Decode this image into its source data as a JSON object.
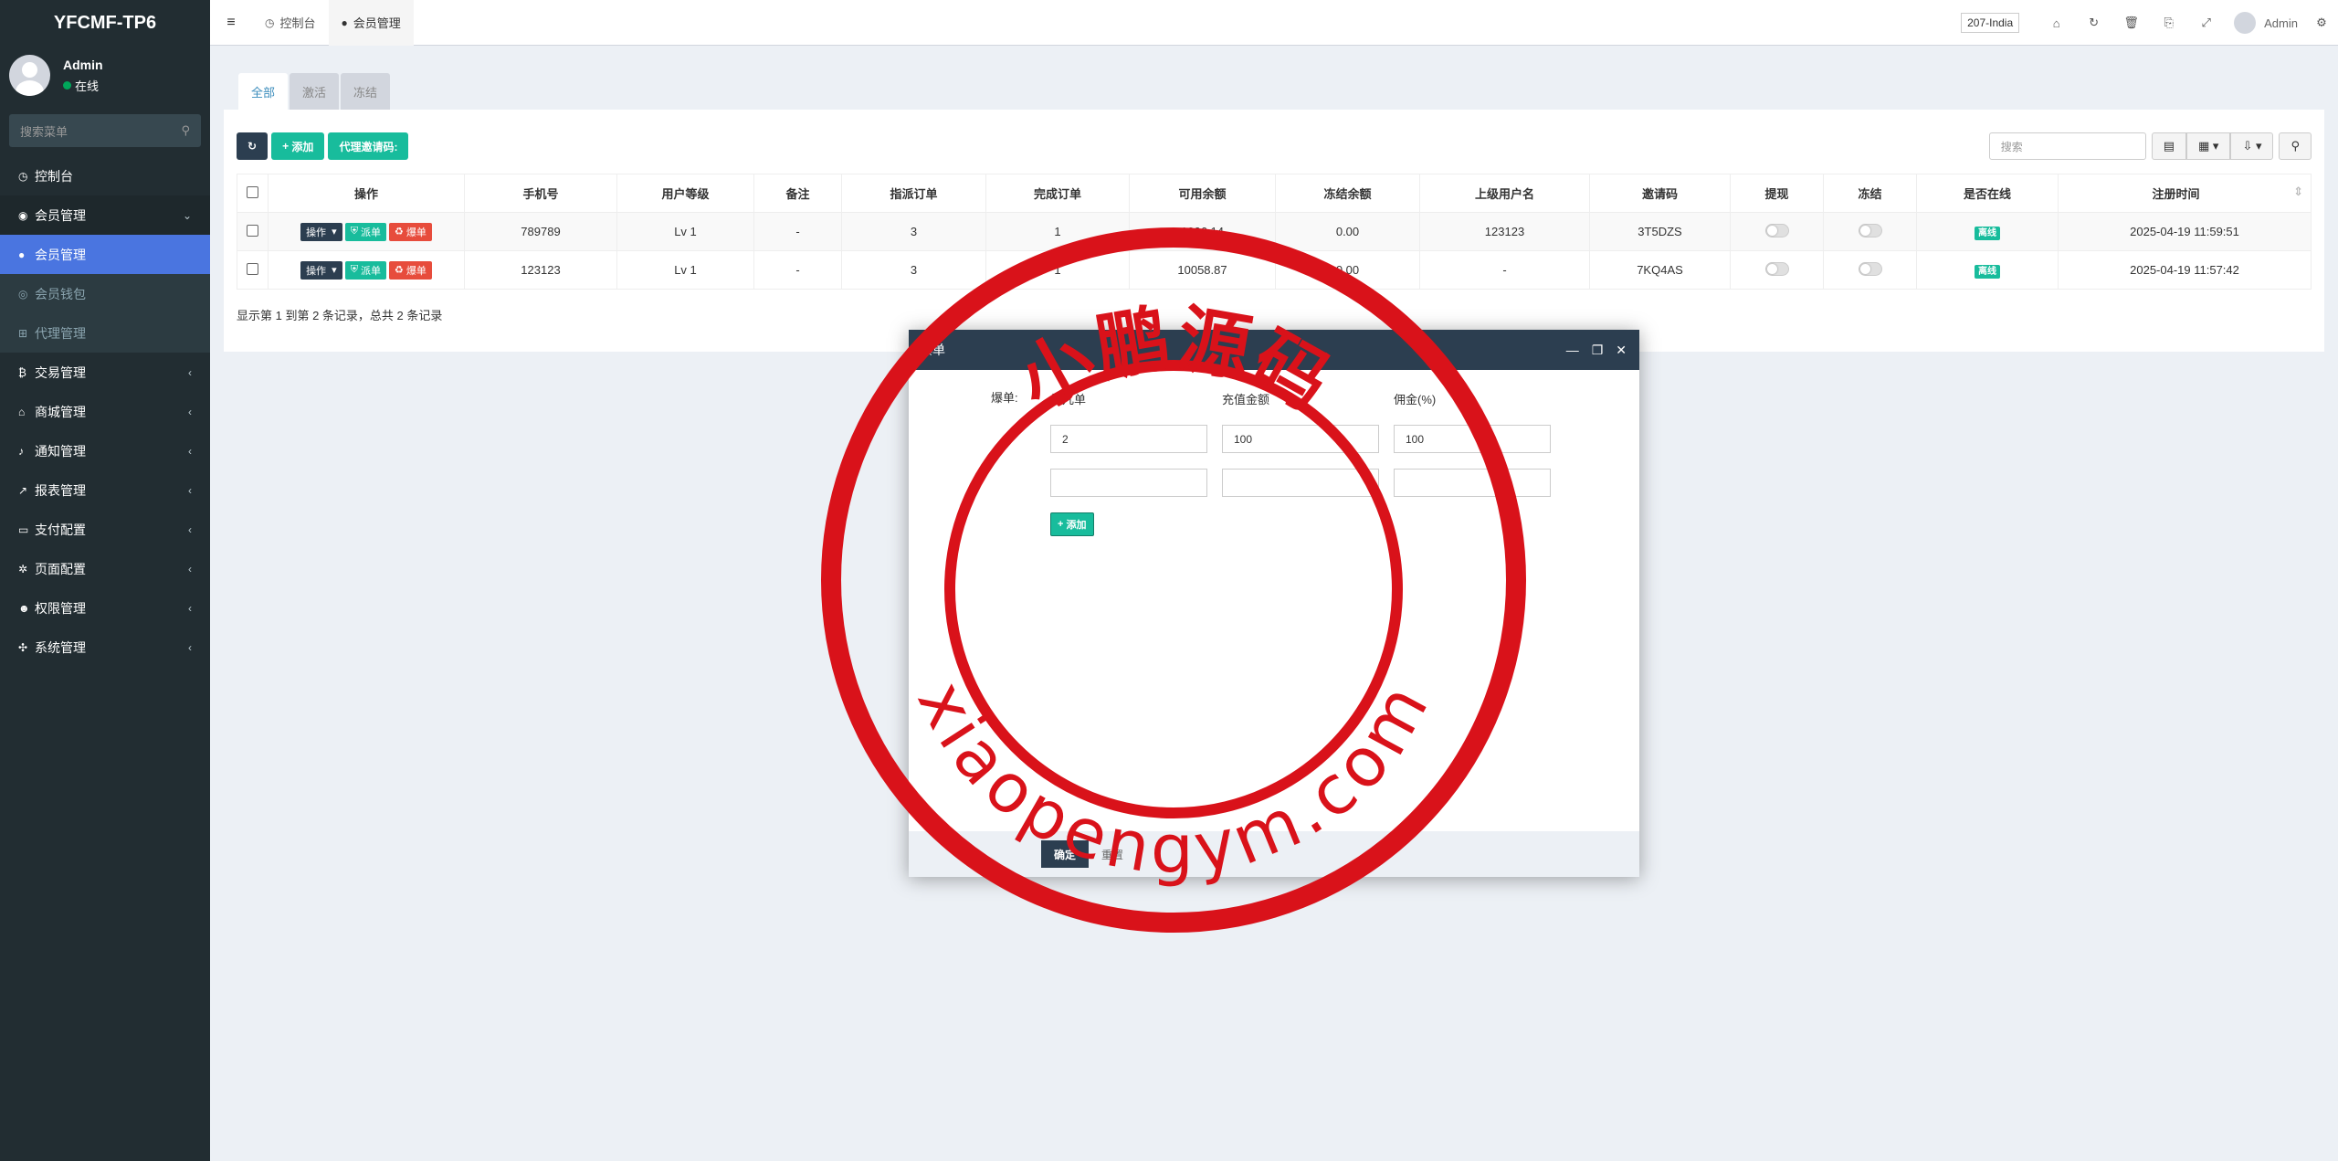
{
  "app": {
    "title": "YFCMF-TP6"
  },
  "user": {
    "name": "Admin",
    "status": "在线"
  },
  "sidebar": {
    "search_placeholder": "搜索菜单",
    "items": [
      {
        "label": "控制台",
        "icon": "dashboard-icon"
      },
      {
        "label": "会员管理",
        "icon": "user-circle-icon"
      },
      {
        "label": "会员管理",
        "icon": "user-icon"
      },
      {
        "label": "会员钱包",
        "icon": "wallet-icon"
      },
      {
        "label": "代理管理",
        "icon": "sitemap-icon"
      },
      {
        "label": "交易管理",
        "icon": "bitcoin-icon"
      },
      {
        "label": "商城管理",
        "icon": "home-icon"
      },
      {
        "label": "通知管理",
        "icon": "bell-icon"
      },
      {
        "label": "报表管理",
        "icon": "chart-icon"
      },
      {
        "label": "支付配置",
        "icon": "card-icon"
      },
      {
        "label": "页面配置",
        "icon": "gear-icon"
      },
      {
        "label": "权限管理",
        "icon": "users-icon"
      },
      {
        "label": "系统管理",
        "icon": "cogs-icon"
      }
    ]
  },
  "topbar": {
    "tabs": [
      {
        "label": "控制台"
      },
      {
        "label": "会员管理"
      }
    ],
    "region": "207-India",
    "user": "Admin"
  },
  "filters": {
    "all": "全部",
    "active": "激活",
    "frozen": "冻结"
  },
  "toolbar": {
    "add": "添加",
    "invite": "代理邀请码:",
    "search_placeholder": "搜索"
  },
  "table": {
    "headers": [
      "操作",
      "手机号",
      "用户等级",
      "备注",
      "指派订单",
      "完成订单",
      "可用余额",
      "冻结余额",
      "上级用户名",
      "邀请码",
      "提现",
      "冻结",
      "是否在线",
      "注册时间"
    ],
    "op_labels": {
      "action": "操作",
      "assign": "派单",
      "burst": "爆单"
    },
    "rows": [
      {
        "phone": "789789",
        "level": "Lv 1",
        "note": "-",
        "assigned": "3",
        "done": "1",
        "balance": "1006.14",
        "frozen": "0.00",
        "parent": "123123",
        "code": "3T5DZS",
        "online": "离线",
        "time": "2025-04-19 11:59:51"
      },
      {
        "phone": "123123",
        "level": "Lv 1",
        "note": "-",
        "assigned": "3",
        "done": "1",
        "balance": "10058.87",
        "frozen": "0.00",
        "parent": "-",
        "code": "7KQ4AS",
        "online": "离线",
        "time": "2025-04-19 11:57:42"
      }
    ],
    "pager": "显示第 1 到第 2 条记录，总共 2 条记录"
  },
  "modal": {
    "title": "爆单",
    "field_label": "爆单:",
    "columns": [
      "第几单",
      "充值金额",
      "佣金(%)"
    ],
    "row1": [
      "2",
      "100",
      "100"
    ],
    "add": "添加",
    "confirm": "确定",
    "reset": "重置"
  },
  "watermark": {
    "top": "小鹏源码",
    "bottom": "xiaopengym.com",
    "color": "#d9121a"
  }
}
